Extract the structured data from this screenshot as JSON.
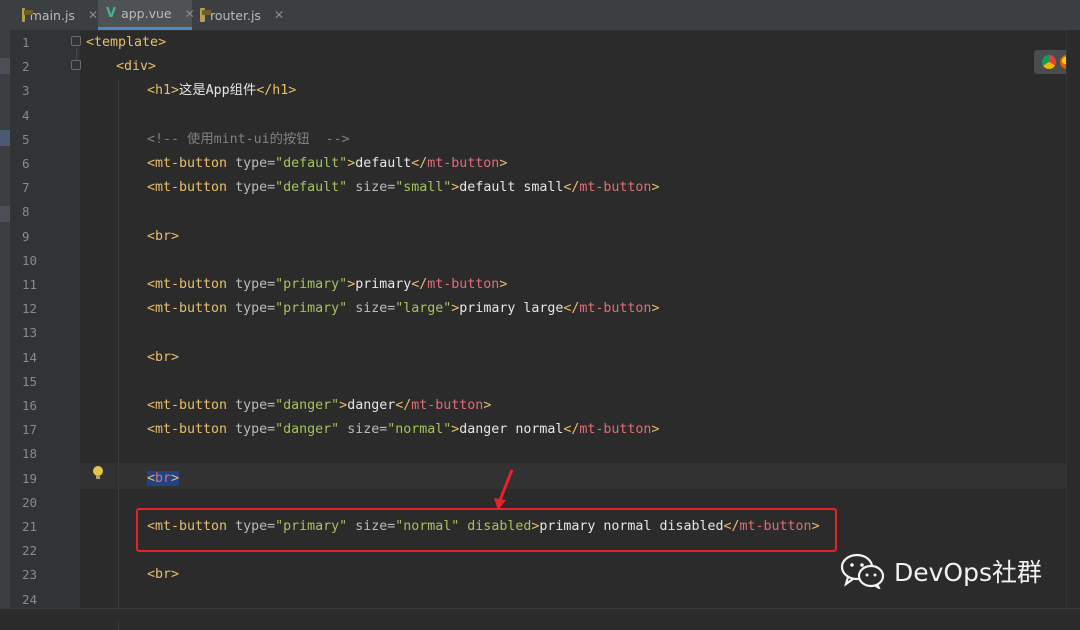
{
  "tabs": [
    {
      "label": "main.js",
      "icon": "js-file-icon",
      "active": false
    },
    {
      "label": "app.vue",
      "icon": "vue-file-icon",
      "active": true
    },
    {
      "label": "router.js",
      "icon": "js-file-icon",
      "active": false
    }
  ],
  "line_numbers": [
    "1",
    "2",
    "3",
    "4",
    "5",
    "6",
    "7",
    "8",
    "9",
    "10",
    "11",
    "12",
    "13",
    "14",
    "15",
    "16",
    "17",
    "18",
    "19",
    "20",
    "21",
    "22",
    "23",
    "24"
  ],
  "code": {
    "l1_tag": "template",
    "l2_tag": "div",
    "l3_open": "h1",
    "l3_text": "这是App组件",
    "l3_close": "h1",
    "l5_comment": "<!-- 使用mint-ui的按钮  -->",
    "mt": "mt-button",
    "type_attr": "type=",
    "size_attr": "size=",
    "disabled_attr": "disabled",
    "v_default": "\"default\"",
    "v_small": "\"small\"",
    "v_primary": "\"primary\"",
    "v_large": "\"large\"",
    "v_danger": "\"danger\"",
    "v_normal": "\"normal\"",
    "l6_text": "default",
    "l7_text": "default small",
    "br": "br",
    "l11_text": "primary",
    "l12_text": "primary large",
    "l16_text": "danger",
    "l17_text": "danger normal",
    "l21_text": "primary normal disabled"
  },
  "watermark": {
    "label": "DevOps社群",
    "icon": "wechat-icon"
  },
  "browser_icons": [
    "chrome-icon",
    "firefox-icon"
  ],
  "colors": {
    "highlight": "#e8222a",
    "tag_name": "#e8bf6a",
    "attr_value": "#a5c25c",
    "closing_tag_name": "#e06c75"
  }
}
